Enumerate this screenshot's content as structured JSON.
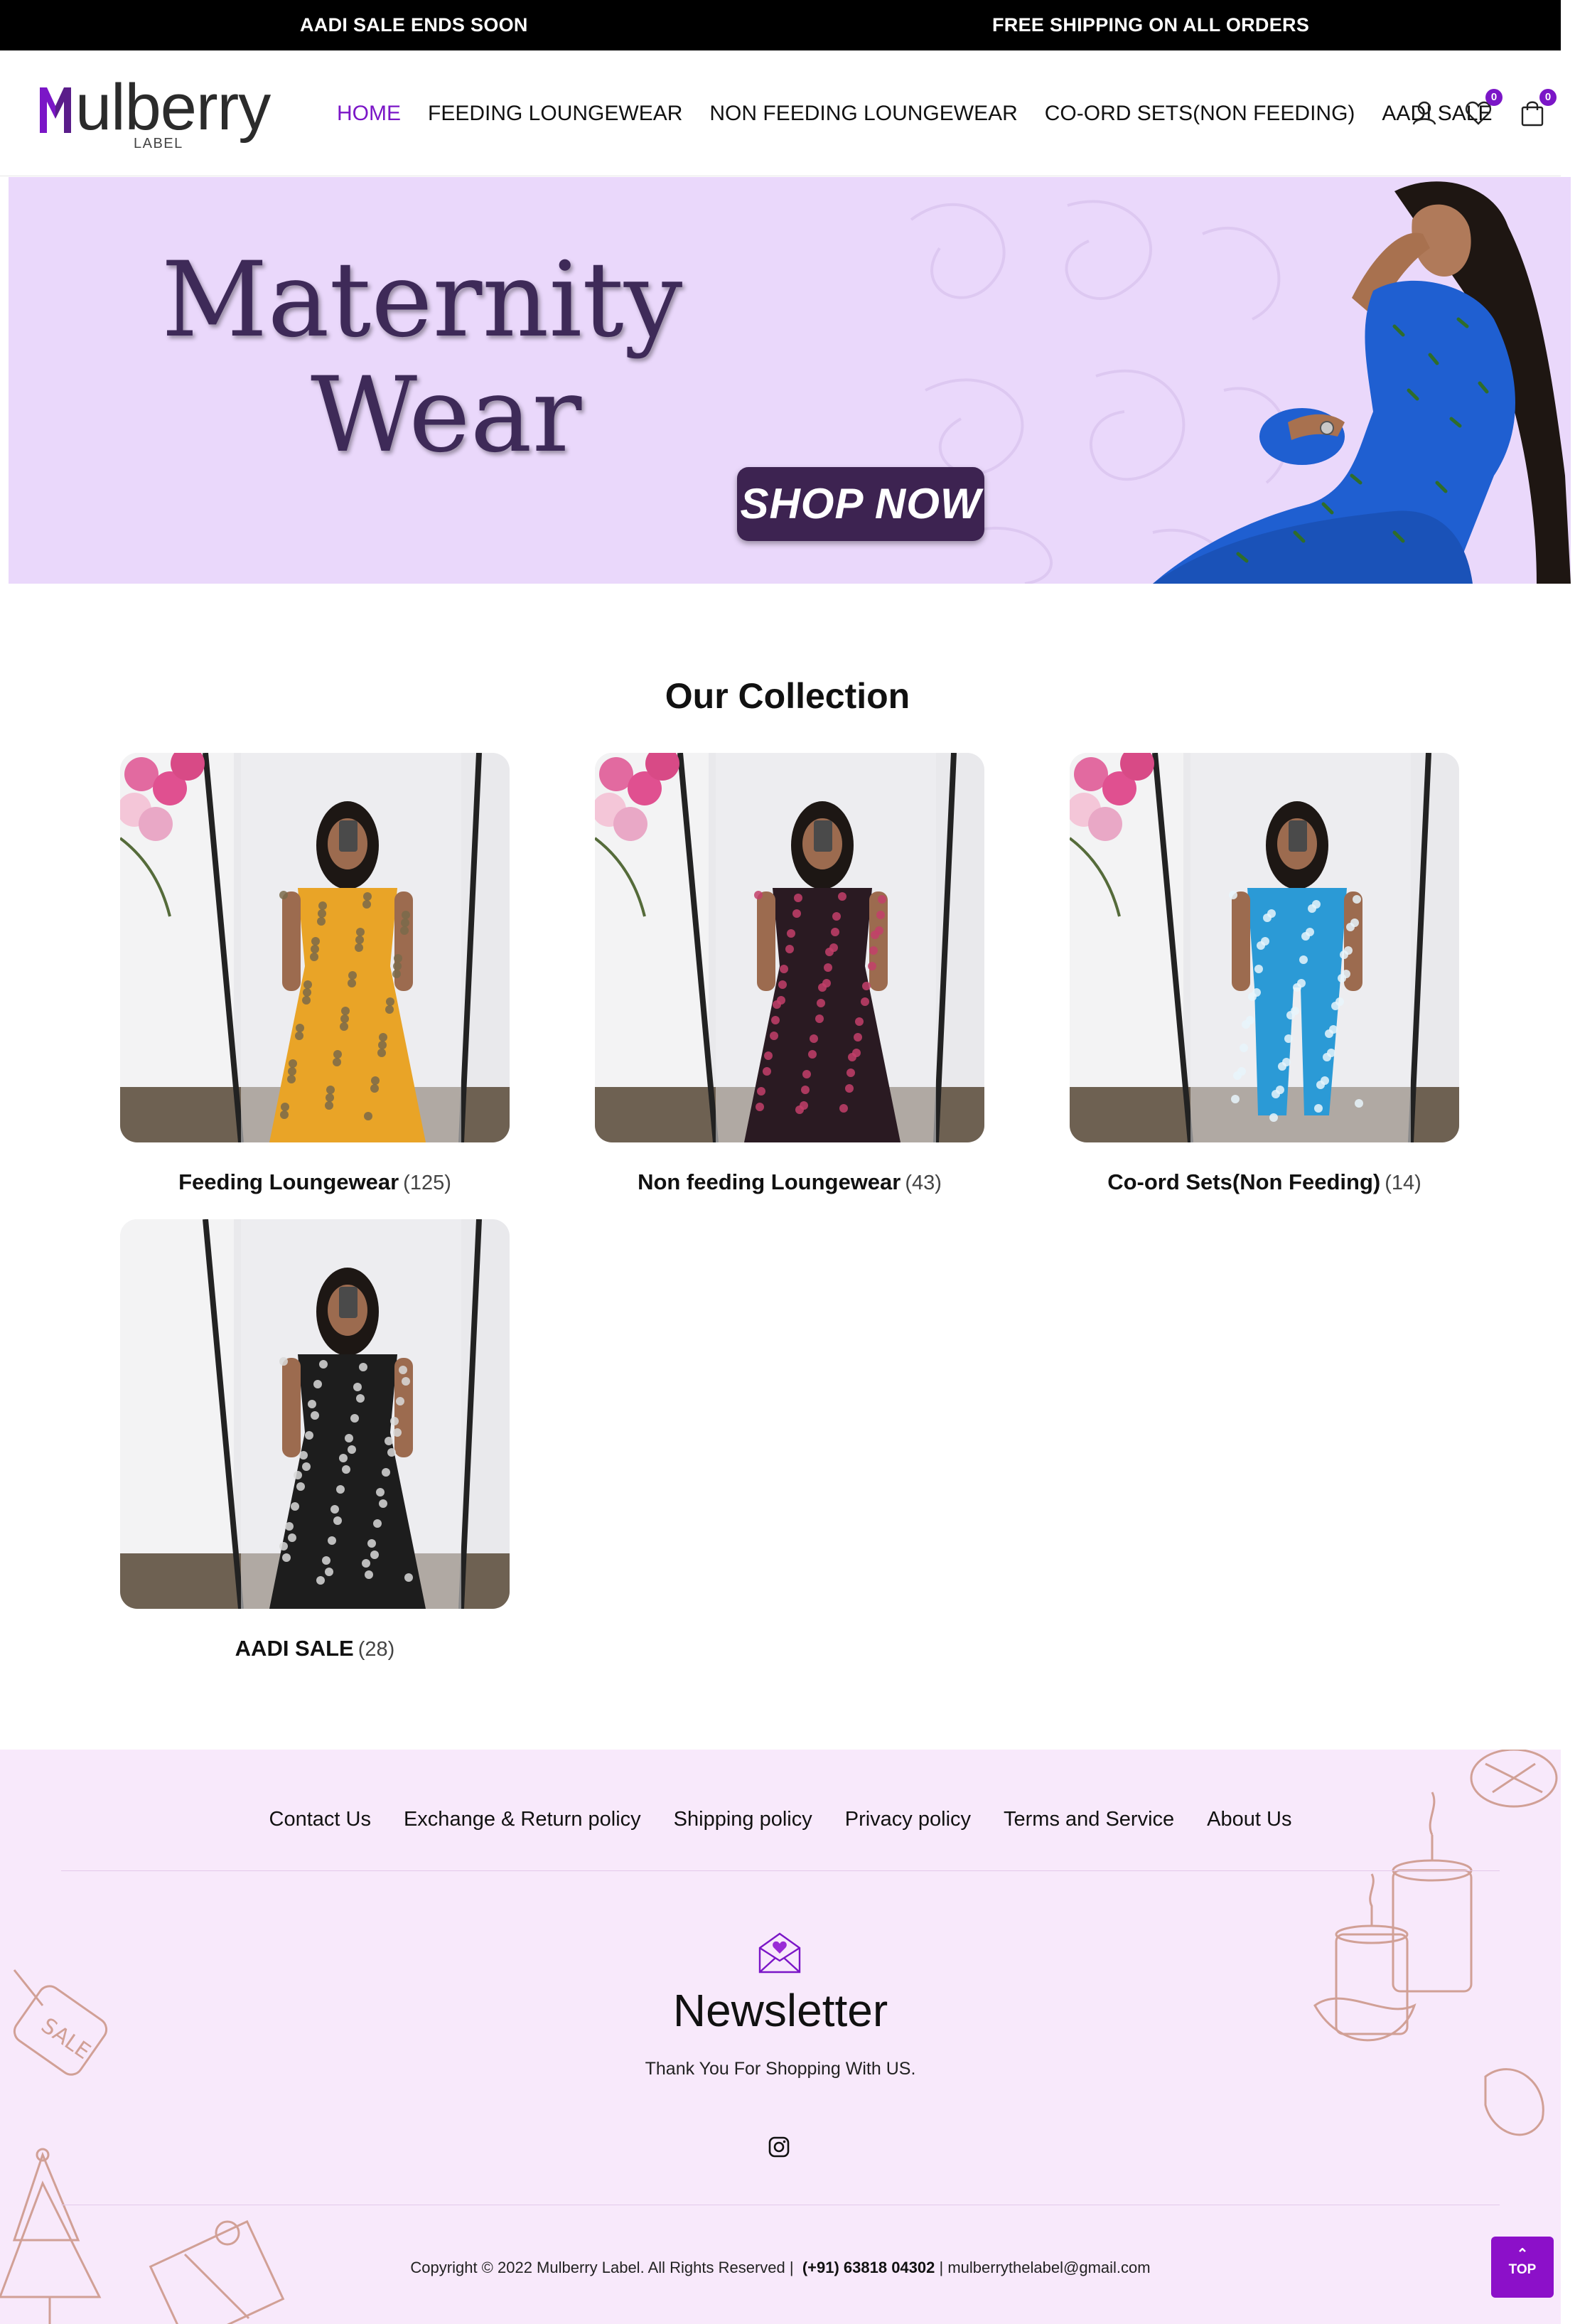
{
  "announcement": {
    "left": "AADI SALE ENDS SOON",
    "right": "FREE SHIPPING ON ALL ORDERS"
  },
  "header": {
    "logo": {
      "word": "ulberry",
      "letter": "M",
      "sub": "LABEL"
    },
    "nav": [
      {
        "label": "HOME",
        "active": true
      },
      {
        "label": "FEEDING LOUNGEWEAR"
      },
      {
        "label": "NON FEEDING LOUNGEWEAR"
      },
      {
        "label": "CO-ORD SETS(NON FEEDING)"
      },
      {
        "label": "AADI SALE"
      }
    ],
    "icons": [
      "user-icon",
      "heart-icon",
      "bag-icon"
    ],
    "wishlist_count": "0",
    "cart_count": "0"
  },
  "hero": {
    "line1": "Maternity",
    "line2": "Wear",
    "cta": "SHOP NOW"
  },
  "collection": {
    "title": "Our Collection",
    "items": [
      {
        "name": "Feeding Loungewear",
        "count": "(125)",
        "dress": "#e9a427",
        "pattern": "#7a6a4a"
      },
      {
        "name": "Non feeding Loungewear",
        "count": "(43)",
        "dress": "#2a1a22",
        "pattern": "#c3406a"
      },
      {
        "name": "Co-ord Sets(Non Feeding)",
        "count": "(14)",
        "dress": "#2b9ad6",
        "pattern": "#e8f4fb"
      },
      {
        "name": "AADI SALE",
        "count": "(28)",
        "dress": "#1d1d1d",
        "pattern": "#d9d9d9"
      }
    ]
  },
  "footer": {
    "links": [
      "Contact Us",
      "Exchange & Return policy",
      "Shipping policy",
      "Privacy policy",
      "Terms and Service",
      "About Us"
    ],
    "newsletter_title": "Newsletter",
    "newsletter_text": "Thank You For Shopping With US.",
    "copyright": "Copyright © 2022 Mulberry Label. All Rights Reserved |",
    "phone": "(+91) 63818 04302",
    "email_sep": "|",
    "email": "mulberrythelabel@gmail.com",
    "top_label": "TOP"
  },
  "colors": {
    "accent": "#7b16c7",
    "hero_bg": "#ead8fb",
    "footer_bg": "#f8e9fb"
  }
}
